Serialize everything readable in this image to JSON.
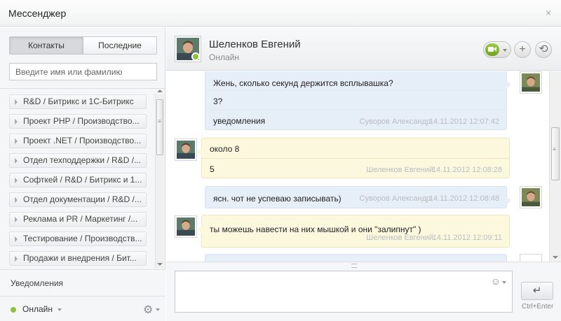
{
  "window": {
    "title": "Мессенджер",
    "close_glyph": "×"
  },
  "left": {
    "tabs": [
      {
        "label": "Контакты"
      },
      {
        "label": "Последние"
      }
    ],
    "search_placeholder": "Введите имя или фамилию",
    "groups": [
      {
        "label": "R&D / Битрикс и 1С-Битрикс"
      },
      {
        "label": "Проект PHP / Производство..."
      },
      {
        "label": "Проект .NET / Производство..."
      },
      {
        "label": "Отдел техподдержки / R&D /..."
      },
      {
        "label": "Софткей / R&D / Битрикс и 1..."
      },
      {
        "label": "Отдел документации / R&D /..."
      },
      {
        "label": "Реклама и PR / Маркетинг /..."
      },
      {
        "label": "Тестирование / Производств..."
      },
      {
        "label": "Продажи и внедрения / Бит..."
      }
    ],
    "notifications_label": "Уведомления",
    "status_label": "Онлайн",
    "status_color": "#8bc33b"
  },
  "chat": {
    "contact_name": "Шеленков Евгений",
    "contact_status": "Онлайн",
    "accent_green": "#7cb82f",
    "messages": [
      {
        "direction": "out",
        "lines": [
          {
            "text": "Жень, сколько секунд держится всплывашка?"
          },
          {
            "text": "3?"
          },
          {
            "text": "уведомления",
            "author": "Суворов Александр",
            "time": "14.11.2012 12:07:42"
          }
        ]
      },
      {
        "direction": "in",
        "lines": [
          {
            "text": "около 8"
          },
          {
            "text": "5",
            "author": "Шеленков Евгений",
            "time": "14.11.2012 12:08:28"
          }
        ]
      },
      {
        "direction": "out",
        "lines": [
          {
            "text": "ясн. чот не успеваю записывать)",
            "author": "Суворов Александр",
            "time": "14.11.2012 12:08:48"
          }
        ]
      },
      {
        "direction": "in",
        "lines": [
          {
            "text": "ты можешь навести на них мышкой и они \"залипнут\" )",
            "author": "Шеленков Евгений",
            "time": "14.11.2012 12:09:11"
          }
        ]
      }
    ]
  },
  "input": {
    "send_hint": "Ctrl+Enter",
    "send_glyph": "↵",
    "smile_glyph": "☺"
  },
  "icons": {
    "plus": "+",
    "history": "⟲",
    "gear": "⚙"
  }
}
